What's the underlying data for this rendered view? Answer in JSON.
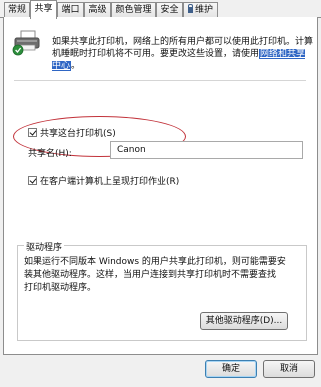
{
  "tabs": [
    {
      "label": "常规",
      "active": false
    },
    {
      "label": "共享",
      "active": true
    },
    {
      "label": "端口",
      "active": false
    },
    {
      "label": "高级",
      "active": false
    },
    {
      "label": "颜色管理",
      "active": false
    },
    {
      "label": "安全",
      "active": false
    },
    {
      "label": "维护",
      "active": false,
      "icon": "lock-icon"
    }
  ],
  "info": {
    "line1": "如果共享此打印机，网络上的所有用户都可以使用此打印机。计算",
    "line2_before": "机睡眠时打印机将不可用。要更改这些设置，请使用",
    "line2_link": "网络和共享中心",
    "line2_after": "。"
  },
  "share": {
    "checkbox_label": "共享这台打印机(S)",
    "checked": true,
    "name_label": "共享名(H):",
    "name_value": "Canon"
  },
  "client_render": {
    "checkbox_label": "在客户端计算机上呈现打印作业(R)",
    "checked": true
  },
  "drivers": {
    "group_title": "驱动程序",
    "line1": "如果运行不同版本 Windows 的用户共享此打印机，则可能需要安",
    "line2": "装其他驱动程序。这样，当用户连接到共享打印机时不需要查找",
    "line3": "打印机驱动程序。",
    "button_label": "其他驱动程序(D)..."
  },
  "footer": {
    "ok_label": "确定",
    "cancel_label": "取消"
  }
}
